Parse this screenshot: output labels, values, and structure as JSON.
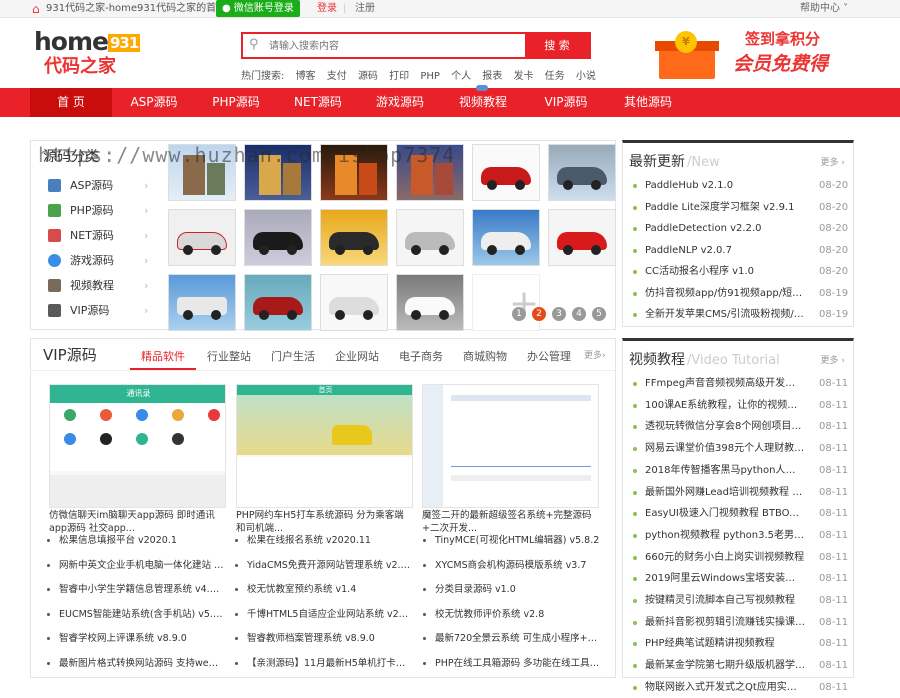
{
  "topbar": {
    "site_home": "931代码之家-home931代码之家的首页",
    "wechat_login": "微信账号登录",
    "login": "登录",
    "sep": "|",
    "register": "注册",
    "help": "帮助中心"
  },
  "logo": {
    "text1": "home",
    "text1_num": "931",
    "text2": "代码之家"
  },
  "search": {
    "placeholder": "请输入搜索内容",
    "button": "搜 索"
  },
  "hot": {
    "label": "热门搜索:",
    "words": [
      "博客",
      "支付",
      "源码",
      "打印",
      "PHP",
      "个人",
      "报表",
      "发卡",
      "任务",
      "小说"
    ]
  },
  "promo": {
    "line1": "签到拿积分",
    "line2": "会员免费得"
  },
  "nav": {
    "items": [
      "首 页",
      "ASP源码",
      "PHP源码",
      "NET源码",
      "游戏源码",
      "视频教程",
      "VIP源码",
      "其他源码"
    ]
  },
  "watermark": "https://www.huzhan.com/ishop7374",
  "categories": {
    "title": "源码分类",
    "items": [
      {
        "label": "ASP源码",
        "icon": "monitor-icon"
      },
      {
        "label": "PHP源码",
        "icon": "phone-icon"
      },
      {
        "label": "NET源码",
        "icon": "net-icon"
      },
      {
        "label": "游戏源码",
        "icon": "game-icon"
      },
      {
        "label": "视频教程",
        "icon": "video-icon"
      },
      {
        "label": "VIP源码",
        "icon": "vip-icon"
      }
    ]
  },
  "pager": [
    "1",
    "2",
    "3",
    "4",
    "5"
  ],
  "latest": {
    "title": "最新更新",
    "title_en": "/New",
    "more": "更多",
    "items": [
      {
        "text": "PaddleHub v2.1.0",
        "date": "08-20"
      },
      {
        "text": "Paddle Lite深度学习框架 v2.9.1",
        "date": "08-20"
      },
      {
        "text": "PaddleDetection v2.2.0",
        "date": "08-20"
      },
      {
        "text": "PaddleNLP v2.0.7",
        "date": "08-20"
      },
      {
        "text": "CC活动报名小程序 v1.0",
        "date": "08-20"
      },
      {
        "text": "仿抖音视频app/仿91视频app/短视频功...",
        "date": "08-19"
      },
      {
        "text": "全新开发苹果CMS/引流吸粉视频/-两种...",
        "date": "08-19"
      }
    ]
  },
  "video": {
    "title": "视频教程",
    "title_en": "/Video Tutorial",
    "more": "更多",
    "items": [
      {
        "text": "FFmpeg声音音频视频高级开发实战视频...",
        "date": "08-11"
      },
      {
        "text": "100课AE系统教程，让你的视频玩转特...",
        "date": "08-11"
      },
      {
        "text": "透视玩转微信分享会8个网创项目（价值...",
        "date": "08-11"
      },
      {
        "text": "网易云课堂价值398元个人理财教程理财...",
        "date": "08-11"
      },
      {
        "text": "2018年传智播客黑马python人工智能15...",
        "date": "08-11"
      },
      {
        "text": "最新国外网赚Lead培训视频教程 国外网...",
        "date": "08-11"
      },
      {
        "text": "EasyUI极速入门视频教程 BTBOYS社区...",
        "date": "08-11"
      },
      {
        "text": "python视频教程 python3.5老男孩2018...",
        "date": "08-11"
      },
      {
        "text": "660元的财务小白上岗实训视频教程",
        "date": "08-11"
      },
      {
        "text": "2019阿里云Windows宝塔安装部署视频...",
        "date": "08-11"
      },
      {
        "text": "按键精灵引流脚本自己写视频教程",
        "date": "08-11"
      },
      {
        "text": "最新抖音影视剪辑引流赚钱实操课程...",
        "date": "08-11"
      },
      {
        "text": "PHP经典笔试题精讲视频教程",
        "date": "08-11"
      },
      {
        "text": "最新某金学院第七期升级版机器学习视...",
        "date": "08-11"
      },
      {
        "text": "物联网嵌入式开发式之Qt应用实战视频...",
        "date": "08-11"
      }
    ]
  },
  "vip": {
    "title": "VIP源码",
    "tabs": [
      "精品软件",
      "行业整站",
      "门户生活",
      "企业网站",
      "电子商务",
      "商城购物",
      "办公管理",
      "更多"
    ],
    "shots": [
      {
        "caption": "仿微信聊天im脑聊天app源码 即时通讯app源码 社交app...",
        "header": "通讯录"
      },
      {
        "caption": "PHP网约车H5打车系统源码 分为乘客端和司机端...",
        "header": "首页"
      },
      {
        "caption": "魔签二开的最新超级签名系统+完整源码+二次开发...",
        "header": ""
      }
    ],
    "list": [
      "松果信息填报平台 v2020.1",
      "松果在线报名系统 v2020.11",
      "TinyMCE(可视化HTML编辑器) v5.8.2",
      "网新中英文企业手机电脑一体化建站 v5.1",
      "YidaCMS免费开源网站管理系统 v2.0.0...",
      "XYCMS商会机构源码模版系统 v3.7",
      "智睿中小学生学籍信息管理系统 v4.6.0",
      "校无忧教室预约系统 v1.4",
      "分类目录源码 v1.0",
      "EUCMS智能建站系统(含手机站) v5.10...",
      "千博HTML5自适应企业网站系统 v202...",
      "校无忧教师评价系统 v2.8",
      "智睿学校网上评课系统 v8.9.0",
      "智睿教师档案管理系统 v8.9.0",
      "最新720全景云系统 可生成小程序+带P...",
      "最新图片格式转换网站源码 支持webp...",
      "【亲测源码】11月最新H5单机打卡网...",
      "PHP在线工具箱源码 多功能在线工具箱..."
    ]
  }
}
